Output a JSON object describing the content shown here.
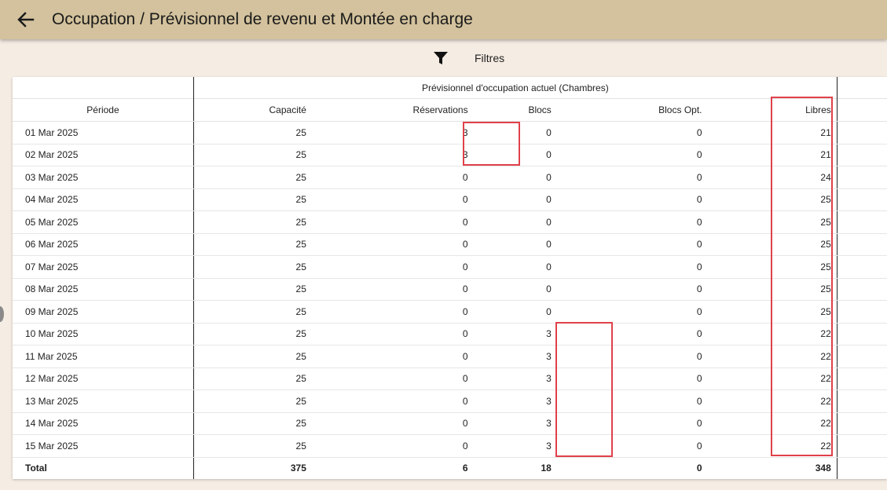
{
  "header": {
    "title": "Occupation / Prévisionnel de revenu et Montée en charge",
    "back_icon": "arrow-left-icon"
  },
  "filters": {
    "label": "Filtres",
    "icon": "funnel-icon"
  },
  "table": {
    "group_header": "Prévisionnel d'occupation actuel (Chambres)",
    "columns": {
      "period": "Période",
      "capacity": "Capacité",
      "reservations": "Réservations",
      "blocs": "Blocs",
      "blocs_opt": "Blocs Opt.",
      "libres": "Libres"
    },
    "rows": [
      {
        "period": "01 Mar 2025",
        "capacity": "25",
        "reservations": "3",
        "blocs": "0",
        "blocs_opt": "0",
        "libres": "21"
      },
      {
        "period": "02 Mar 2025",
        "capacity": "25",
        "reservations": "3",
        "blocs": "0",
        "blocs_opt": "0",
        "libres": "21"
      },
      {
        "period": "03 Mar 2025",
        "capacity": "25",
        "reservations": "0",
        "blocs": "0",
        "blocs_opt": "0",
        "libres": "24"
      },
      {
        "period": "04 Mar 2025",
        "capacity": "25",
        "reservations": "0",
        "blocs": "0",
        "blocs_opt": "0",
        "libres": "25"
      },
      {
        "period": "05 Mar 2025",
        "capacity": "25",
        "reservations": "0",
        "blocs": "0",
        "blocs_opt": "0",
        "libres": "25"
      },
      {
        "period": "06 Mar 2025",
        "capacity": "25",
        "reservations": "0",
        "blocs": "0",
        "blocs_opt": "0",
        "libres": "25"
      },
      {
        "period": "07 Mar 2025",
        "capacity": "25",
        "reservations": "0",
        "blocs": "0",
        "blocs_opt": "0",
        "libres": "25"
      },
      {
        "period": "08 Mar 2025",
        "capacity": "25",
        "reservations": "0",
        "blocs": "0",
        "blocs_opt": "0",
        "libres": "25"
      },
      {
        "period": "09 Mar 2025",
        "capacity": "25",
        "reservations": "0",
        "blocs": "0",
        "blocs_opt": "0",
        "libres": "25"
      },
      {
        "period": "10 Mar 2025",
        "capacity": "25",
        "reservations": "0",
        "blocs": "3",
        "blocs_opt": "0",
        "libres": "22"
      },
      {
        "period": "11 Mar 2025",
        "capacity": "25",
        "reservations": "0",
        "blocs": "3",
        "blocs_opt": "0",
        "libres": "22"
      },
      {
        "period": "12 Mar 2025",
        "capacity": "25",
        "reservations": "0",
        "blocs": "3",
        "blocs_opt": "0",
        "libres": "22"
      },
      {
        "period": "13 Mar 2025",
        "capacity": "25",
        "reservations": "0",
        "blocs": "3",
        "blocs_opt": "0",
        "libres": "22"
      },
      {
        "period": "14 Mar 2025",
        "capacity": "25",
        "reservations": "0",
        "blocs": "3",
        "blocs_opt": "0",
        "libres": "22"
      },
      {
        "period": "15 Mar 2025",
        "capacity": "25",
        "reservations": "0",
        "blocs": "3",
        "blocs_opt": "0",
        "libres": "22"
      }
    ],
    "total": {
      "label": "Total",
      "capacity": "375",
      "reservations": "6",
      "blocs": "18",
      "blocs_opt": "0",
      "libres": "348"
    }
  },
  "colors": {
    "appbar": "#d3c29d",
    "background": "#f5ece3",
    "highlight": "#e0414b"
  }
}
